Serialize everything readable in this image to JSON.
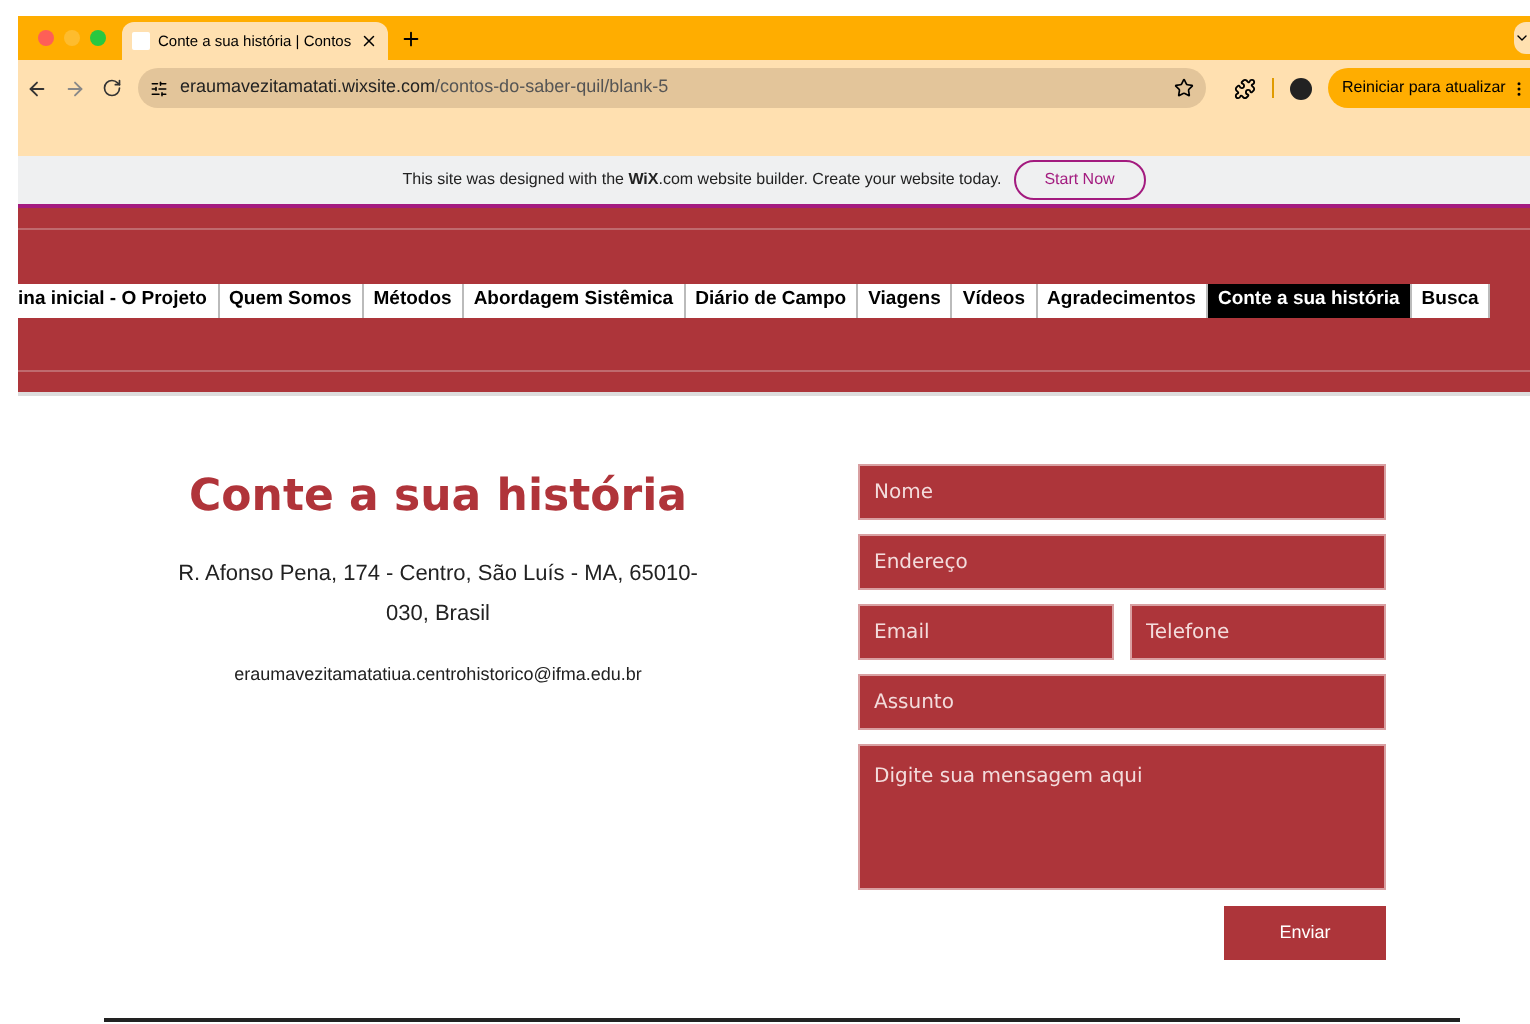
{
  "browser": {
    "tab": {
      "title": "Conte a sua história | Contos"
    },
    "url": {
      "host": "eraumavezitamatati.wixsite.com",
      "path": "/contos-do-saber-quil/blank-5"
    },
    "update_button": "Reiniciar para atualizar"
  },
  "wix_banner": {
    "text": "This site was designed with the **WiX**.com website builder. Create your website today.",
    "button": "Start Now"
  },
  "nav": [
    {
      "label": "ina inicial - O Projeto",
      "selected": false
    },
    {
      "label": "Quem Somos",
      "selected": false
    },
    {
      "label": "Métodos",
      "selected": false
    },
    {
      "label": "Abordagem Sistêmica",
      "selected": false
    },
    {
      "label": "Diário de Campo",
      "selected": false
    },
    {
      "label": "Viagens",
      "selected": false
    },
    {
      "label": "Vídeos",
      "selected": false
    },
    {
      "label": "Agradecimentos",
      "selected": false
    },
    {
      "label": "Conte a sua história",
      "selected": true
    },
    {
      "label": "Busca",
      "selected": false
    }
  ],
  "contact": {
    "title": "Conte a sua história",
    "address": "R. Afonso Pena, 174 - Centro, São Luís - MA, 65010-030, Brasil",
    "email": "eraumavezitamatatiua.centrohistorico@ifma.edu.br"
  },
  "form": {
    "fields": [
      {
        "placeholder": "Nome",
        "kind": "full"
      },
      {
        "placeholder": "Endereço",
        "kind": "full"
      },
      {
        "placeholder": "Email",
        "kind": "half"
      },
      {
        "placeholder": "Telefone",
        "kind": "half"
      },
      {
        "placeholder": "Assunto",
        "kind": "full"
      },
      {
        "placeholder": "Digite sua mensagem aqui",
        "kind": "message"
      }
    ],
    "submit": "Enviar"
  }
}
